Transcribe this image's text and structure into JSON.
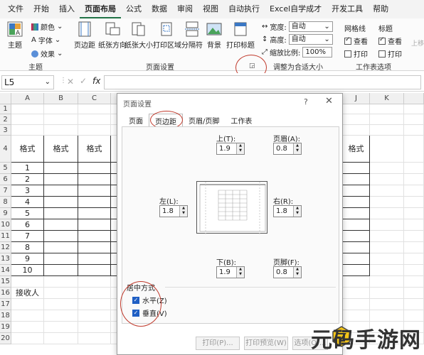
{
  "menu": [
    "文件",
    "开始",
    "插入",
    "页面布局",
    "公式",
    "数据",
    "审阅",
    "视图",
    "自动执行",
    "Excel自学成才",
    "开发工具",
    "帮助"
  ],
  "active_menu": 3,
  "ribbon": {
    "theme_label": "主题",
    "theme_items": [
      "颜色",
      "字体",
      "效果"
    ],
    "theme_group": "主题",
    "page_buttons": [
      "页边距",
      "纸张方向",
      "纸张大小",
      "打印区域",
      "分隔符",
      "背景",
      "打印标题"
    ],
    "page_group": "页面设置",
    "fit": {
      "width_label": "宽度:",
      "width_val": "自动",
      "height_label": "高度:",
      "height_val": "自动",
      "scale_label": "缩放比例:",
      "scale_val": "100%"
    },
    "fit_group": "调整为合适大小",
    "grid_title": "网格线",
    "grid_view": "查看",
    "grid_print": "打印",
    "head_title": "标题",
    "head_view": "查看",
    "head_print": "打印",
    "sheet_group": "工作表选项",
    "upper_label": "上移"
  },
  "formula": {
    "namebox": "L5",
    "fx": "fx",
    "value": ""
  },
  "columns": [
    "A",
    "B",
    "C",
    "J",
    "K"
  ],
  "rows": [
    "1",
    "2",
    "3",
    "4",
    "5",
    "6",
    "7",
    "8",
    "9",
    "10",
    "11",
    "12",
    "13",
    "14",
    "15",
    "16",
    "17",
    "18",
    "19",
    "20"
  ],
  "table": {
    "header": [
      "格式",
      "格式",
      "格式",
      "格式"
    ],
    "numbers": [
      "1",
      "2",
      "3",
      "4",
      "5",
      "6",
      "7",
      "8",
      "9",
      "10"
    ],
    "receiver": "接收人"
  },
  "dialog": {
    "title": "页面设置",
    "help": "?",
    "close": "✕",
    "tabs": [
      "页面",
      "页边距",
      "页眉/页脚",
      "工作表"
    ],
    "active_tab": 1,
    "top_label": "上(T):",
    "top_val": "1.9",
    "header_label": "页眉(A):",
    "header_val": "0.8",
    "left_label": "左(L):",
    "left_val": "1.8",
    "right_label": "右(R):",
    "right_val": "1.8",
    "bottom_label": "下(B):",
    "bottom_val": "1.9",
    "footer_label": "页脚(F):",
    "footer_val": "0.8",
    "center_title": "居中方式",
    "horizontal": "水平(Z)",
    "vertical": "垂直(V)",
    "buttons": [
      "打印(P)...",
      "打印预览(W)",
      "选项(O)..."
    ]
  },
  "watermark": "元码手游网",
  "colors": {
    "accent": "#217346",
    "ring": "#c0392b",
    "check": "#1f5fc4"
  }
}
